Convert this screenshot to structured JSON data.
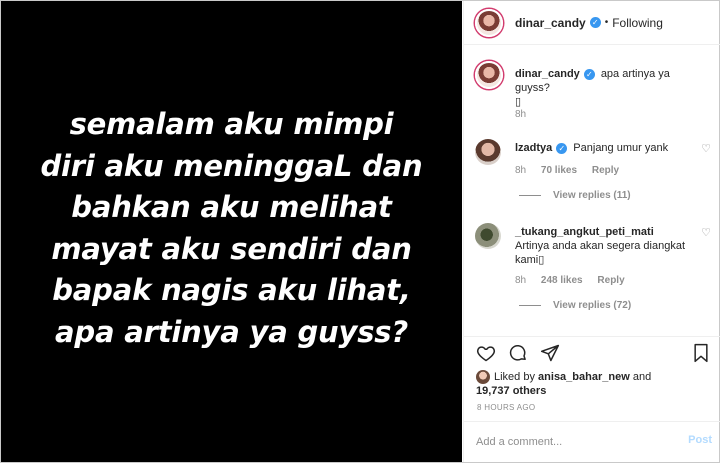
{
  "post": {
    "image_text": "semalam aku mimpi\ndiri aku meninggaL dan\nbahkan aku melihat\nmayat aku sendiri dan\nbapak nagis aku lihat,\napa artinya ya guyss?"
  },
  "header": {
    "username": "dinar_candy",
    "dot": "•",
    "follow_status": "Following"
  },
  "caption": {
    "username": "dinar_candy",
    "text": "apa artinya ya guyss?",
    "emoji": "▯",
    "time": "8h"
  },
  "comments": [
    {
      "username": "lzadtya",
      "verified": true,
      "text": "Panjang umur yank",
      "time": "8h",
      "likes": "70 likes",
      "reply_label": "Reply",
      "view_replies": "View replies (11)"
    },
    {
      "username": "_tukang_angkut_peti_mati",
      "verified": false,
      "text": "Artinya anda akan segera diangkat kami▯",
      "time": "8h",
      "likes": "248 likes",
      "reply_label": "Reply",
      "view_replies": "View replies (72)"
    }
  ],
  "actions": {
    "like_icon": "heart-icon",
    "comment_icon": "comment-icon",
    "share_icon": "share-icon",
    "save_icon": "bookmark-icon"
  },
  "likes": {
    "prefix": "Liked by",
    "user": "anisa_bahar_new",
    "and": "and",
    "count": "19,737 others"
  },
  "timestamp": "8 HOURS AGO",
  "add_comment": {
    "placeholder": "Add a comment...",
    "post_label": "Post"
  },
  "colors": {
    "verified_blue": "#3897f0",
    "post_button_disabled": "#b3dbff",
    "secondary_text": "#8e8e8e"
  }
}
